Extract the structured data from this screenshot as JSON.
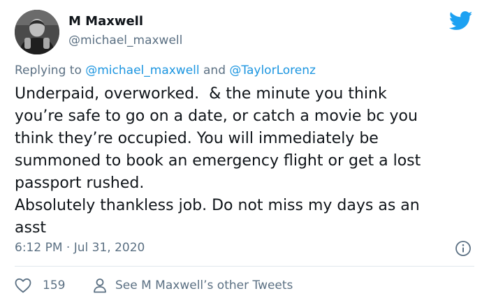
{
  "author": {
    "name": "M Maxwell",
    "handle": "@michael_maxwell"
  },
  "reply": {
    "prefix": "Replying to ",
    "mention_1": "@michael_maxwell",
    "conjunction": " and ",
    "mention_2": "@TaylorLorenz"
  },
  "tweet": {
    "text": "Underpaid, overworked.  & the minute you think\nyou’re safe to go on a date, or catch a movie bc you\nthink they’re occupied. You will immediately be\nsummoned to book an emergency flight or get a lost\npassport rushed.\nAbsolutely thankless job. Do not miss my days as an\nasst",
    "timestamp": "6:12 PM · Jul 31, 2020"
  },
  "actions": {
    "like_count": "159",
    "other_tweets_label": "See M Maxwell’s other Tweets"
  },
  "icons": {
    "brand": "twitter-bird-icon",
    "info": "info-icon",
    "like": "heart-icon",
    "profile": "person-icon"
  },
  "colors": {
    "brand_blue": "#1da1f2",
    "link_blue": "#1b95e0",
    "secondary_text": "#5b7083",
    "primary_text": "#0f1419",
    "divider": "#e1e8ed"
  }
}
